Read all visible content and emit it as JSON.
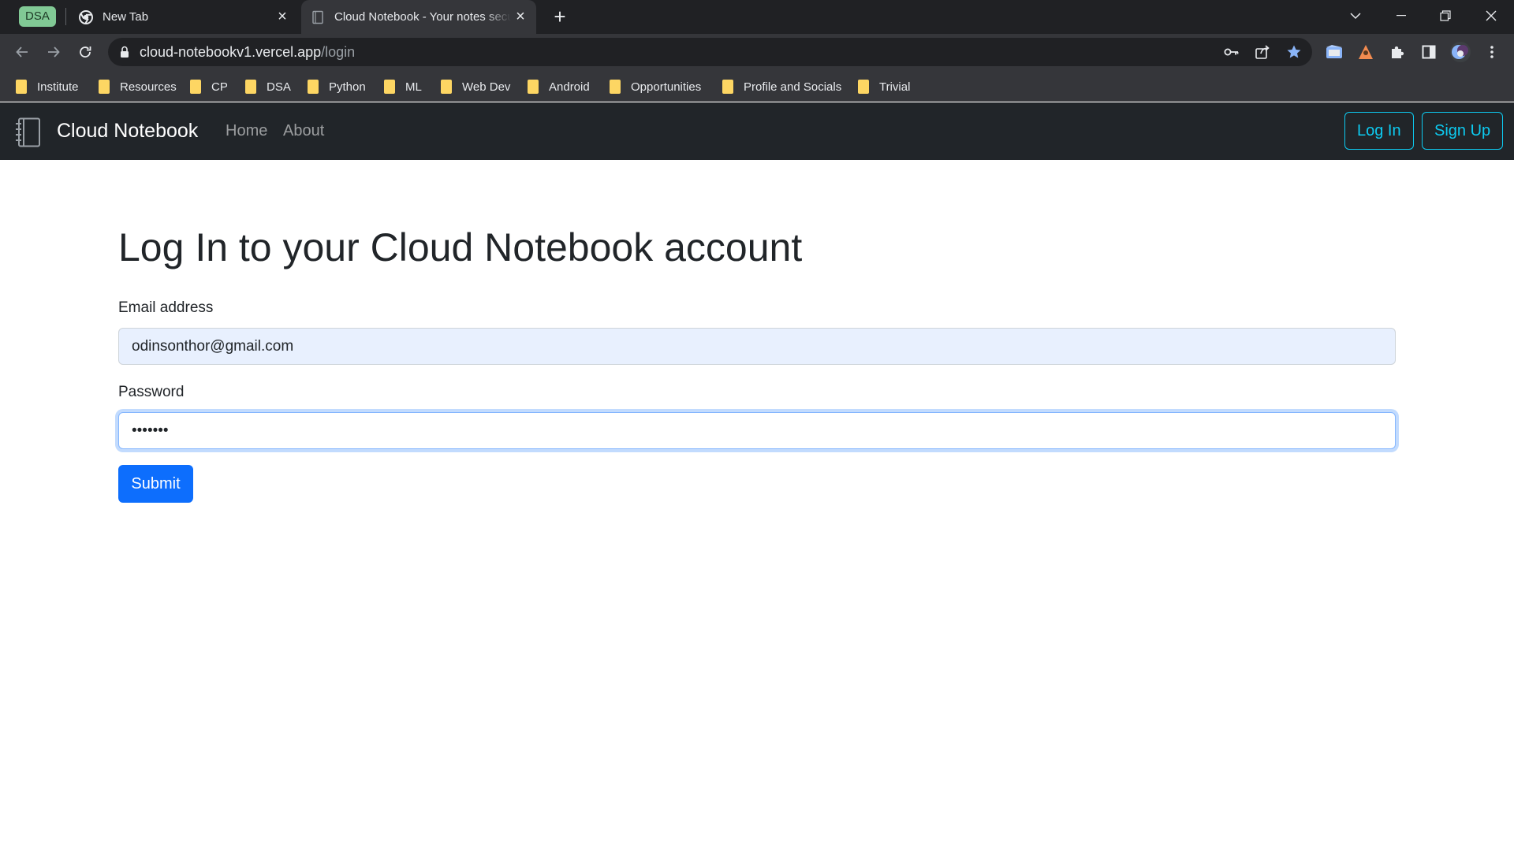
{
  "browser": {
    "tab_group": {
      "label": "DSA",
      "color": "#81c995"
    },
    "tabs": [
      {
        "title": "New Tab",
        "icon": "chrome-icon",
        "active": false
      },
      {
        "title": "Cloud Notebook - Your notes secured",
        "icon": "page-icon",
        "active": true
      }
    ],
    "url": {
      "host": "cloud-notebookv1.vercel.app",
      "path": "/login"
    },
    "bookmarks": [
      "Institute",
      "Resources",
      "CP",
      "DSA",
      "Python",
      "ML",
      "Web Dev",
      "Android",
      "Opportunities",
      "Profile and Socials",
      "Trivial"
    ]
  },
  "navbar": {
    "brand": "Cloud Notebook",
    "brand_icon": "notebook-icon",
    "links": [
      "Home",
      "About"
    ],
    "login_label": "Log In",
    "signup_label": "Sign Up",
    "accent_color": "#0dcaf0"
  },
  "form": {
    "title": "Log In to your Cloud Notebook account",
    "email_label": "Email address",
    "email_value": "odinsonthor@gmail.com",
    "password_label": "Password",
    "password_value": "•••••••",
    "submit_label": "Submit",
    "primary_color": "#0d6efd"
  }
}
